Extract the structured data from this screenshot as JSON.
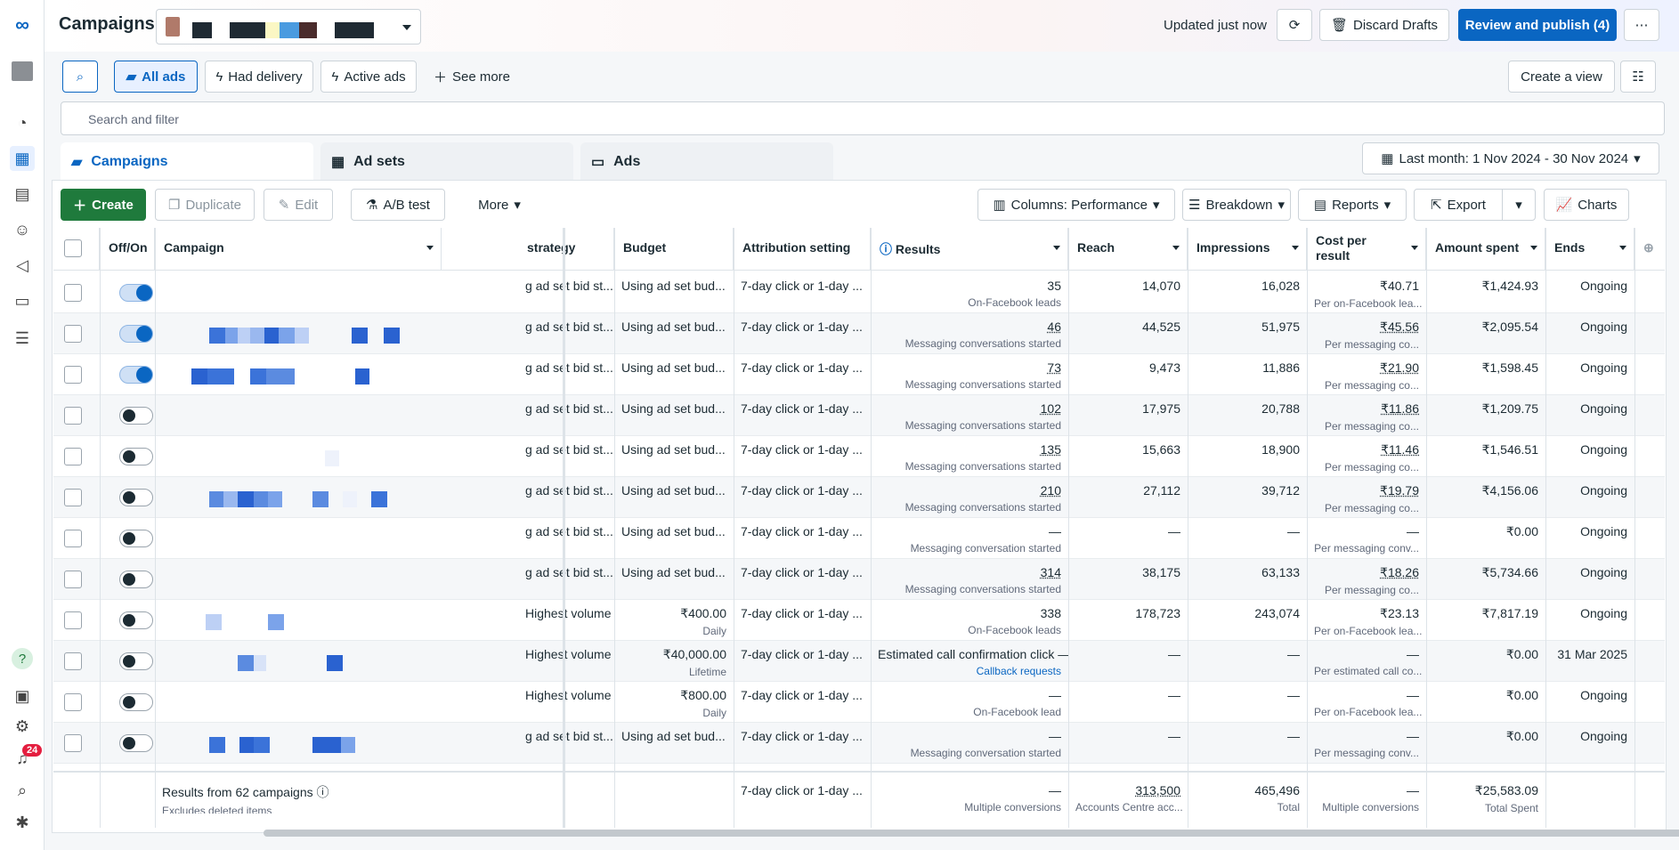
{
  "header": {
    "title": "Campaigns",
    "updated": "Updated just now",
    "discard": "Discard Drafts",
    "review": "Review and publish (4)"
  },
  "filters": {
    "all_ads": "All ads",
    "had_delivery": "Had delivery",
    "active_ads": "Active ads",
    "see_more": "See more",
    "create_view": "Create a view",
    "search_placeholder": "Search and filter"
  },
  "tabs": {
    "campaigns": "Campaigns",
    "ad_sets": "Ad sets",
    "ads": "Ads"
  },
  "date_range": "Last month: 1 Nov 2024 - 30 Nov 2024",
  "toolbar": {
    "create": "Create",
    "duplicate": "Duplicate",
    "edit": "Edit",
    "ab_test": "A/B test",
    "more": "More",
    "columns": "Columns: Performance",
    "breakdown": "Breakdown",
    "reports": "Reports",
    "export": "Export",
    "charts": "Charts"
  },
  "columns": {
    "off_on": "Off/On",
    "campaign": "Campaign",
    "strategy": "strategy",
    "budget": "Budget",
    "attribution": "Attribution setting",
    "results": "Results",
    "reach": "Reach",
    "impressions": "Impressions",
    "cost_per_result_1": "Cost per",
    "cost_per_result_2": "result",
    "amount_spent": "Amount spent",
    "ends": "Ends"
  },
  "rows": [
    {
      "on": true,
      "strategy": "g ad set bid st...",
      "budget": "Using ad set bud...",
      "budget_sub": "",
      "attr": "7-day click or 1-day ...",
      "results": "35",
      "results_sub": "On-Facebook leads",
      "reach": "14,070",
      "impr": "16,028",
      "cpr": "₹40.71",
      "cpr_sub": "Per on-Facebook lea...",
      "spent": "₹1,424.93",
      "ends": "Ongoing"
    },
    {
      "on": true,
      "strategy": "g ad set bid st...",
      "budget": "Using ad set bud...",
      "budget_sub": "",
      "attr": "7-day click or 1-day ...",
      "results": "46",
      "results_sub": "Messaging conversations started",
      "reach": "44,525",
      "impr": "51,975",
      "cpr": "₹45.56",
      "cpr_sub": "Per messaging co...",
      "spent": "₹2,095.54",
      "ends": "Ongoing"
    },
    {
      "on": true,
      "strategy": "g ad set bid st...",
      "budget": "Using ad set bud...",
      "budget_sub": "",
      "attr": "7-day click or 1-day ...",
      "results": "73",
      "results_sub": "Messaging conversations started",
      "reach": "9,473",
      "impr": "11,886",
      "cpr": "₹21.90",
      "cpr_sub": "Per messaging co...",
      "spent": "₹1,598.45",
      "ends": "Ongoing"
    },
    {
      "on": false,
      "strategy": "g ad set bid st...",
      "budget": "Using ad set bud...",
      "budget_sub": "",
      "attr": "7-day click or 1-day ...",
      "results": "102",
      "results_sub": "Messaging conversations started",
      "reach": "17,975",
      "impr": "20,788",
      "cpr": "₹11.86",
      "cpr_sub": "Per messaging co...",
      "spent": "₹1,209.75",
      "ends": "Ongoing"
    },
    {
      "on": false,
      "strategy": "g ad set bid st...",
      "budget": "Using ad set bud...",
      "budget_sub": "",
      "attr": "7-day click or 1-day ...",
      "results": "135",
      "results_sub": "Messaging conversations started",
      "reach": "15,663",
      "impr": "18,900",
      "cpr": "₹11.46",
      "cpr_sub": "Per messaging co...",
      "spent": "₹1,546.51",
      "ends": "Ongoing"
    },
    {
      "on": false,
      "strategy": "g ad set bid st...",
      "budget": "Using ad set bud...",
      "budget_sub": "",
      "attr": "7-day click or 1-day ...",
      "results": "210",
      "results_sub": "Messaging conversations started",
      "reach": "27,112",
      "impr": "39,712",
      "cpr": "₹19.79",
      "cpr_sub": "Per messaging co...",
      "spent": "₹4,156.06",
      "ends": "Ongoing"
    },
    {
      "on": false,
      "strategy": "g ad set bid st...",
      "budget": "Using ad set bud...",
      "budget_sub": "",
      "attr": "7-day click or 1-day ...",
      "results": "—",
      "results_sub": "Messaging conversation started",
      "reach": "—",
      "impr": "—",
      "cpr": "—",
      "cpr_sub": "Per messaging conv...",
      "spent": "₹0.00",
      "ends": "Ongoing"
    },
    {
      "on": false,
      "strategy": "g ad set bid st...",
      "budget": "Using ad set bud...",
      "budget_sub": "",
      "attr": "7-day click or 1-day ...",
      "results": "314",
      "results_sub": "Messaging conversations started",
      "reach": "38,175",
      "impr": "63,133",
      "cpr": "₹18.26",
      "cpr_sub": "Per messaging co...",
      "spent": "₹5,734.66",
      "ends": "Ongoing"
    },
    {
      "on": false,
      "strategy": "Highest volume",
      "budget": "₹400.00",
      "budget_sub": "Daily",
      "attr": "7-day click or 1-day ...",
      "results": "338",
      "results_sub": "On-Facebook leads",
      "reach": "178,723",
      "impr": "243,074",
      "cpr": "₹23.13",
      "cpr_sub": "Per on-Facebook lea...",
      "spent": "₹7,817.19",
      "ends": "Ongoing"
    },
    {
      "on": false,
      "strategy": "Highest volume",
      "budget": "₹40,000.00",
      "budget_sub": "Lifetime",
      "attr": "7-day click or 1-day ...",
      "results": "Estimated call confirmation click —",
      "results_sub": "Callback requests",
      "reach": "—",
      "impr": "—",
      "cpr": "—",
      "cpr_sub": "Per estimated call co...",
      "spent": "₹0.00",
      "ends": "31 Mar 2025"
    },
    {
      "on": false,
      "strategy": "Highest volume",
      "budget": "₹800.00",
      "budget_sub": "Daily",
      "attr": "7-day click or 1-day ...",
      "results": "—",
      "results_sub": "On-Facebook lead",
      "reach": "—",
      "impr": "—",
      "cpr": "—",
      "cpr_sub": "Per on-Facebook lea...",
      "spent": "₹0.00",
      "ends": "Ongoing"
    },
    {
      "on": false,
      "strategy": "g ad set bid st...",
      "budget": "Using ad set bud...",
      "budget_sub": "",
      "attr": "7-day click or 1-day ...",
      "results": "—",
      "results_sub": "Messaging conversation started",
      "reach": "—",
      "impr": "—",
      "cpr": "—",
      "cpr_sub": "Per messaging conv...",
      "spent": "₹0.00",
      "ends": "Ongoing"
    }
  ],
  "footer": {
    "results_from": "Results from 62 campaigns",
    "excludes": "Excludes deleted items",
    "attr": "7-day click or 1-day ...",
    "results": "—",
    "results_sub": "Multiple conversions",
    "reach": "313,500",
    "reach_sub": "Accounts Centre acc...",
    "impr": "465,496",
    "impr_sub": "Total",
    "cpr": "—",
    "cpr_sub": "Multiple conversions",
    "spent": "₹25,583.09",
    "spent_sub": "Total Spent"
  },
  "notifications_count": "24",
  "colors": {
    "accent": "#0a66c2",
    "create_green": "#1f7a3c"
  }
}
